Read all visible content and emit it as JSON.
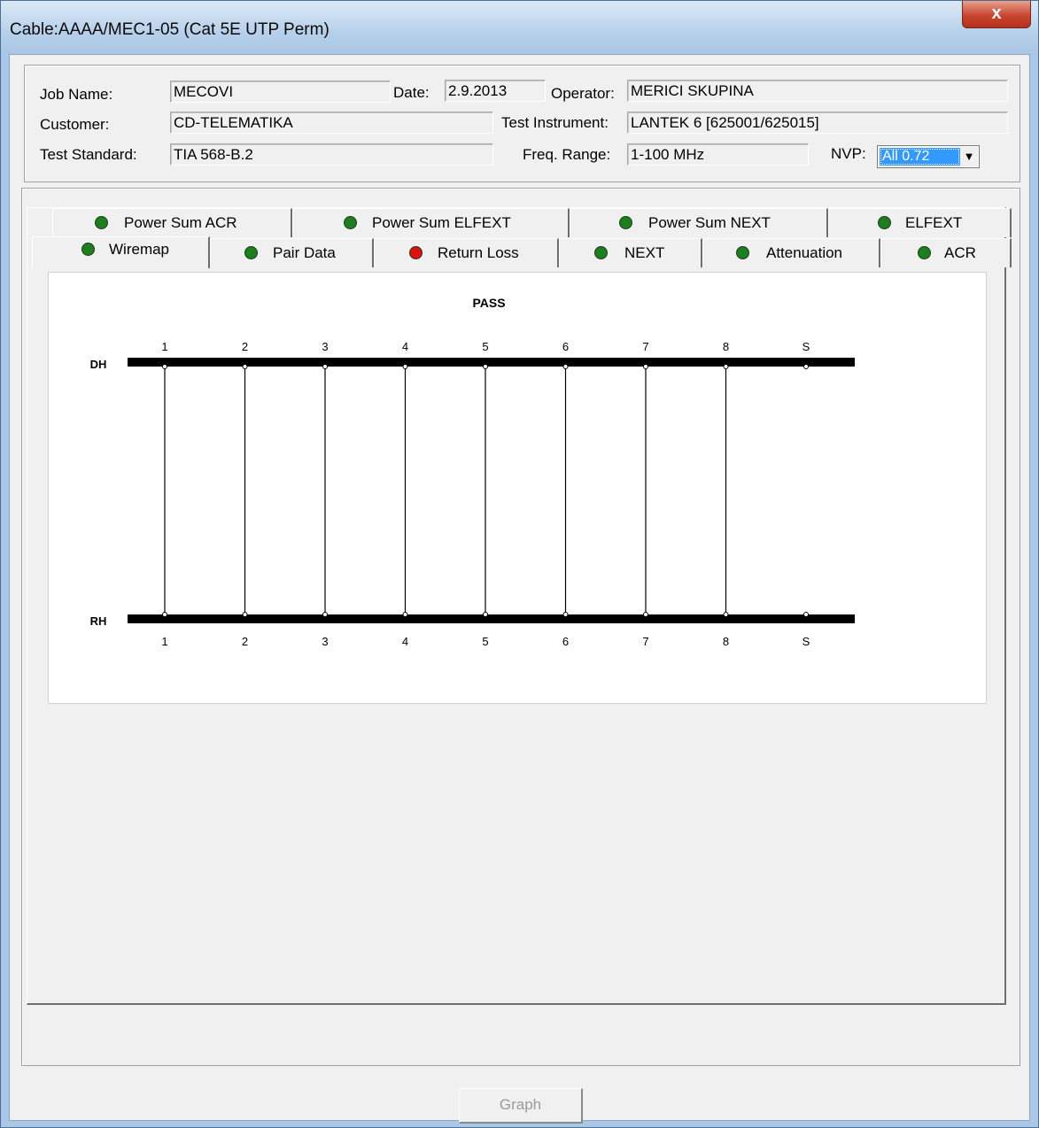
{
  "window": {
    "title": "Cable:AAAA/MEC1-05 (Cat 5E UTP Perm)",
    "close_glyph": "x"
  },
  "header": {
    "job_name_label": "Job Name:",
    "job_name": "MECOVI",
    "date_label": "Date:",
    "date": "2.9.2013",
    "operator_label": "Operator:",
    "operator": "MERICI SKUPINA",
    "customer_label": "Customer:",
    "customer": "CD-TELEMATIKA",
    "test_instrument_label": "Test Instrument:",
    "test_instrument": "LANTEK 6 [625001/625015]",
    "test_standard_label": "Test Standard:",
    "test_standard": "TIA 568-B.2",
    "freq_range_label": "Freq. Range:",
    "freq_range": "1-100 MHz",
    "nvp_label": "NVP:",
    "nvp_value": "All  0.72"
  },
  "tabs_row1": [
    {
      "label": "Power Sum ACR",
      "status": "green"
    },
    {
      "label": "Power Sum ELFEXT",
      "status": "green"
    },
    {
      "label": "Power Sum NEXT",
      "status": "green"
    },
    {
      "label": "ELFEXT",
      "status": "green"
    }
  ],
  "tabs_row2": [
    {
      "label": "Wiremap",
      "status": "green",
      "active": true
    },
    {
      "label": "Pair Data",
      "status": "green"
    },
    {
      "label": "Return Loss",
      "status": "red"
    },
    {
      "label": "NEXT",
      "status": "green"
    },
    {
      "label": "Attenuation",
      "status": "green"
    },
    {
      "label": "ACR",
      "status": "green"
    }
  ],
  "status_colors": {
    "green": "#1e7d1e",
    "red": "#e01010"
  },
  "wiremap": {
    "result": "PASS",
    "top_label": "DH",
    "bottom_label": "RH",
    "pins": [
      "1",
      "2",
      "3",
      "4",
      "5",
      "6",
      "7",
      "8",
      "S"
    ],
    "connected": [
      true,
      true,
      true,
      true,
      true,
      true,
      true,
      true,
      false
    ]
  },
  "footer": {
    "graph_label": "Graph"
  }
}
